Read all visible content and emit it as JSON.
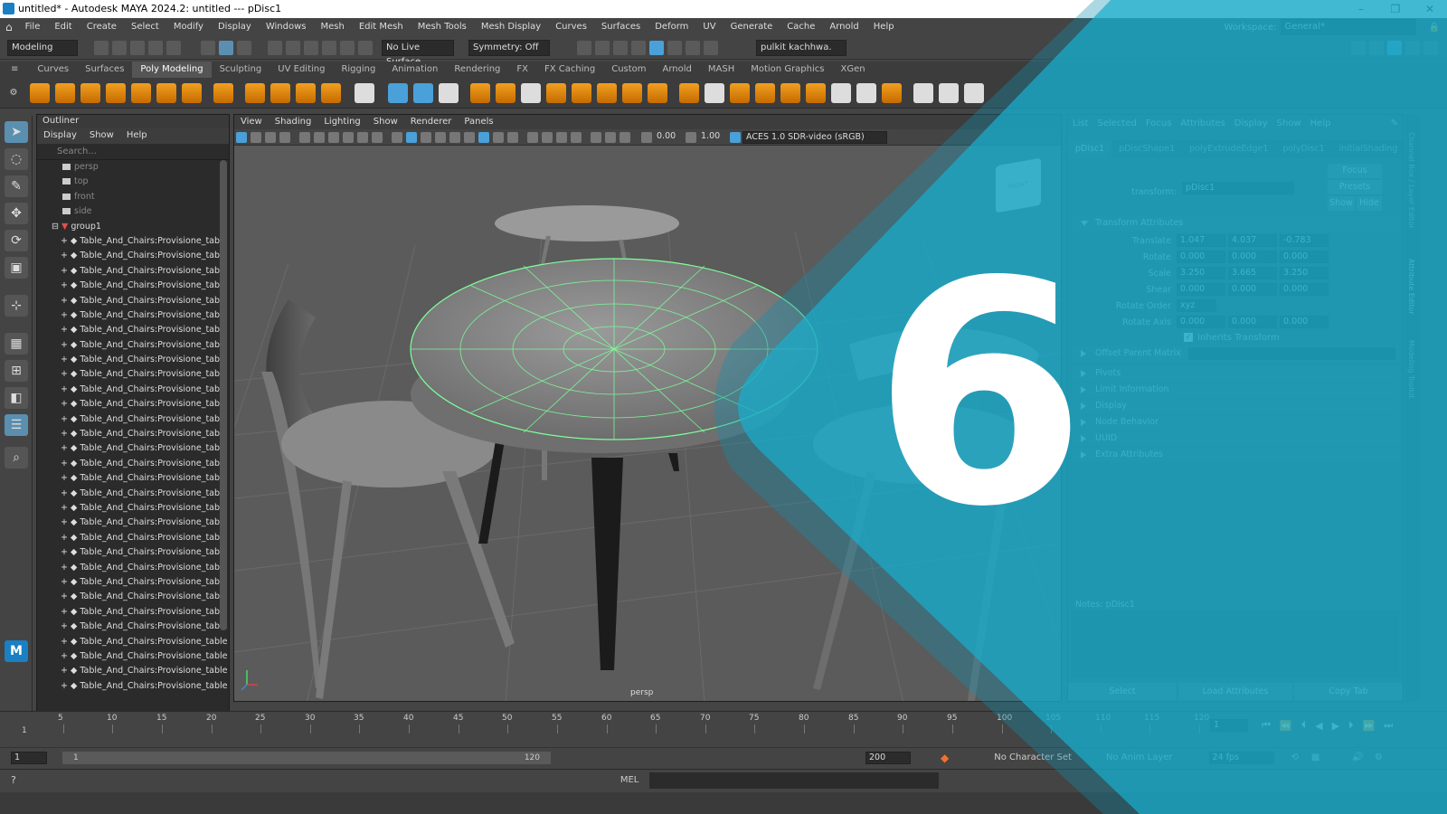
{
  "window": {
    "title": "untitled* - Autodesk MAYA 2024.2: untitled  ---  pDisc1",
    "controls": [
      "–",
      "❐",
      "✕"
    ]
  },
  "menubar": {
    "items": [
      "File",
      "Edit",
      "Create",
      "Select",
      "Modify",
      "Display",
      "Windows",
      "Mesh",
      "Edit Mesh",
      "Mesh Tools",
      "Mesh Display",
      "Curves",
      "Surfaces",
      "Deform",
      "UV",
      "Generate",
      "Cache",
      "Arnold",
      "Help"
    ],
    "workspace_label": "Workspace:",
    "workspace_value": "General*"
  },
  "statusline": {
    "mode": "Modeling",
    "live_surface": "No Live Surface",
    "symmetry": "Symmetry: Off",
    "user": "pulkit kachhwa."
  },
  "shelf": {
    "tabs": [
      "Curves",
      "Surfaces",
      "Poly Modeling",
      "Sculpting",
      "UV Editing",
      "Rigging",
      "Animation",
      "Rendering",
      "FX",
      "FX Caching",
      "Custom",
      "Arnold",
      "MASH",
      "Motion Graphics",
      "XGen"
    ],
    "active": "Poly Modeling"
  },
  "outliner": {
    "title": "Outliner",
    "menu": [
      "Display",
      "Show",
      "Help"
    ],
    "search_placeholder": "Search...",
    "cameras": [
      "persp",
      "top",
      "front",
      "side"
    ],
    "group": "group1",
    "item_label": "Table_And_Chairs:Provisione_table",
    "items": [
      "Table_And_Chairs:Provisione_table",
      "Table_And_Chairs:Provisione_table",
      "Table_And_Chairs:Provisione_table",
      "Table_And_Chairs:Provisione_table",
      "Table_And_Chairs:Provisione_table",
      "Table_And_Chairs:Provisione_table",
      "Table_And_Chairs:Provisione_table",
      "Table_And_Chairs:Provisione_table",
      "Table_And_Chairs:Provisione_table",
      "Table_And_Chairs:Provisione_table",
      "Table_And_Chairs:Provisione_table",
      "Table_And_Chairs:Provisione_table",
      "Table_And_Chairs:Provisione_table",
      "Table_And_Chairs:Provisione_table",
      "Table_And_Chairs:Provisione_table",
      "Table_And_Chairs:Provisione_table",
      "Table_And_Chairs:Provisione_table",
      "Table_And_Chairs:Provisione_table",
      "Table_And_Chairs:Provisione_table",
      "Table_And_Chairs:Provisione_table",
      "Table_And_Chairs:Provisione_table",
      "Table_And_Chairs:Provisione_table",
      "Table_And_Chairs:Provisione_table",
      "Table_And_Chairs:Provisione_table",
      "Table_And_Chairs:Provisione_table",
      "Table_And_Chairs:Provisione_table",
      "Table_And_Chairs:Provisione_table",
      "Table_And_Chairs:Provisione_table",
      "Table_And_Chairs:Provisione_table",
      "Table_And_Chairs:Provisione_table",
      "Table_And_Chairs:Provisione_table"
    ]
  },
  "viewport": {
    "menu": [
      "View",
      "Shading",
      "Lighting",
      "Show",
      "Renderer",
      "Panels"
    ],
    "exposure": "0.00",
    "gamma": "1.00",
    "color_space": "ACES 1.0 SDR-video (sRGB)",
    "camera_label": "persp",
    "viewcube_label": "RIGHT"
  },
  "attribute_editor": {
    "menu": [
      "List",
      "Selected",
      "Focus",
      "Attributes",
      "Display",
      "Show",
      "Help"
    ],
    "node_tabs": [
      "pDisc1",
      "pDiscShape1",
      "polyExtrudeEdge1",
      "polyDisc1",
      "initialShading"
    ],
    "active_tab": "pDisc1",
    "transform_label": "transform:",
    "transform_value": "pDisc1",
    "buttons": {
      "focus": "Focus",
      "presets": "Presets",
      "show": "Show",
      "hide": "Hide"
    },
    "section_transform": "Transform Attributes",
    "rows": [
      {
        "label": "Translate",
        "values": [
          "1.047",
          "4.037",
          "-0.783"
        ]
      },
      {
        "label": "Rotate",
        "values": [
          "0.000",
          "0.000",
          "0.000"
        ]
      },
      {
        "label": "Scale",
        "values": [
          "3.250",
          "3.665",
          "3.250"
        ]
      },
      {
        "label": "Shear",
        "values": [
          "0.000",
          "0.000",
          "0.000"
        ]
      }
    ],
    "rotate_order_label": "Rotate Order",
    "rotate_order_value": "xyz",
    "rotate_axis": {
      "label": "Rotate Axis",
      "values": [
        "0.000",
        "0.000",
        "0.000"
      ]
    },
    "inherits_label": "Inherits Transform",
    "offset_label": "Offset Parent Matrix",
    "sections": [
      "Pivots",
      "Limit Information",
      "Display",
      "Node Behavior",
      "UUID",
      "Extra Attributes"
    ],
    "notes_label": "Notes:  pDisc1",
    "bottom_buttons": [
      "Select",
      "Load Attributes",
      "Copy Tab"
    ]
  },
  "side_tabs": [
    "Channel Box / Layer Editor",
    "Attribute Editor",
    "Modeling Toolkit"
  ],
  "timeline": {
    "ticks": [
      "5",
      "10",
      "15",
      "20",
      "25",
      "30",
      "35",
      "40",
      "45",
      "50",
      "55",
      "60",
      "65",
      "70",
      "75",
      "80",
      "85",
      "90",
      "95",
      "100",
      "105",
      "110",
      "115",
      "120"
    ],
    "start_tick": "1",
    "current_frame": "1"
  },
  "range": {
    "start": "1",
    "inner_start": "1",
    "inner_end": "120",
    "end": "200",
    "character_set": "No Character Set",
    "anim_layer": "No Anim Layer",
    "fps": "24 fps"
  },
  "cmdline": {
    "label": "MEL"
  },
  "overlay": {
    "number": "6",
    "color": "#19a9c9"
  }
}
